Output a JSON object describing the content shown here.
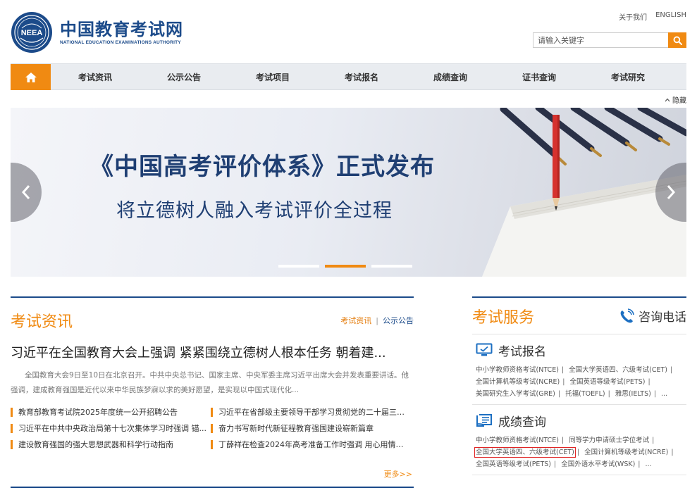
{
  "header": {
    "logo_cn": "中国教育考试网",
    "logo_en": "NATIONAL EDUCATION EXAMINATIONS AUTHORITY",
    "emblem_text": "NEEA",
    "top_links": [
      "关于我们",
      "ENGLISH"
    ],
    "search_placeholder": "请输入关键字"
  },
  "nav": {
    "items": [
      "考试资讯",
      "公示公告",
      "考试项目",
      "考试报名",
      "成绩查询",
      "证书查询",
      "考试研究"
    ]
  },
  "collapse_label": "隐藏",
  "banner": {
    "title": "《中国高考评价体系》正式发布",
    "subtitle": "将立德树人融入考试评价全过程",
    "slides": 3,
    "active_slide": 2
  },
  "news": {
    "title": "考试资讯",
    "tabs": [
      "考试资讯",
      "公示公告"
    ],
    "headline": "习近平在全国教育大会上强调 紧紧围绕立德树人根本任务 朝着建...",
    "summary": "全国教育大会9日至10日在北京召开。中共中央总书记、国家主席、中央军委主席习近平出席大会并发表重要讲话。他强调，建成教育强国是近代以来中华民族梦寐以求的美好愿望，是实现以中国式现代化...",
    "items": [
      "教育部教育考试院2025年度统一公开招聘公告",
      "习近平在省部级主要领导干部学习贯彻党的二十届三中...",
      "习近平在中共中央政治局第十七次集体学习时强调 锚...",
      "奋力书写新时代新征程教育强国建设崭新篇章",
      "建设教育强国的强大思想武器和科学行动指南",
      "丁薛祥在检查2024年高考准备工作时强调 用心用情做..."
    ],
    "more": "更多>>"
  },
  "services": {
    "title": "考试服务",
    "phone_label": "咨询电话",
    "registration": {
      "title": "考试报名",
      "links": [
        "中小学教师资格考试(NTCE)",
        "全国大学英语四、六级考试(CET)",
        "全国计算机等级考试(NCRE)",
        "全国英语等级考试(PETS)",
        "美国研究生入学考试(GRE)",
        "托福(TOEFL)",
        "雅思(IELTS)",
        "..."
      ]
    },
    "scores": {
      "title": "成绩查询",
      "links": [
        "中小学教师资格考试(NTCE)",
        "同等学力申请硕士学位考试",
        "全国大学英语四、六级考试(CET)",
        "全国计算机等级考试(NCRE)",
        "全国英语等级考试(PETS)",
        "全国外语水平考试(WSK)",
        "..."
      ]
    }
  },
  "colors": {
    "accent": "#f08a12",
    "brand": "#1c4b8a",
    "highlight": "#e02424"
  }
}
